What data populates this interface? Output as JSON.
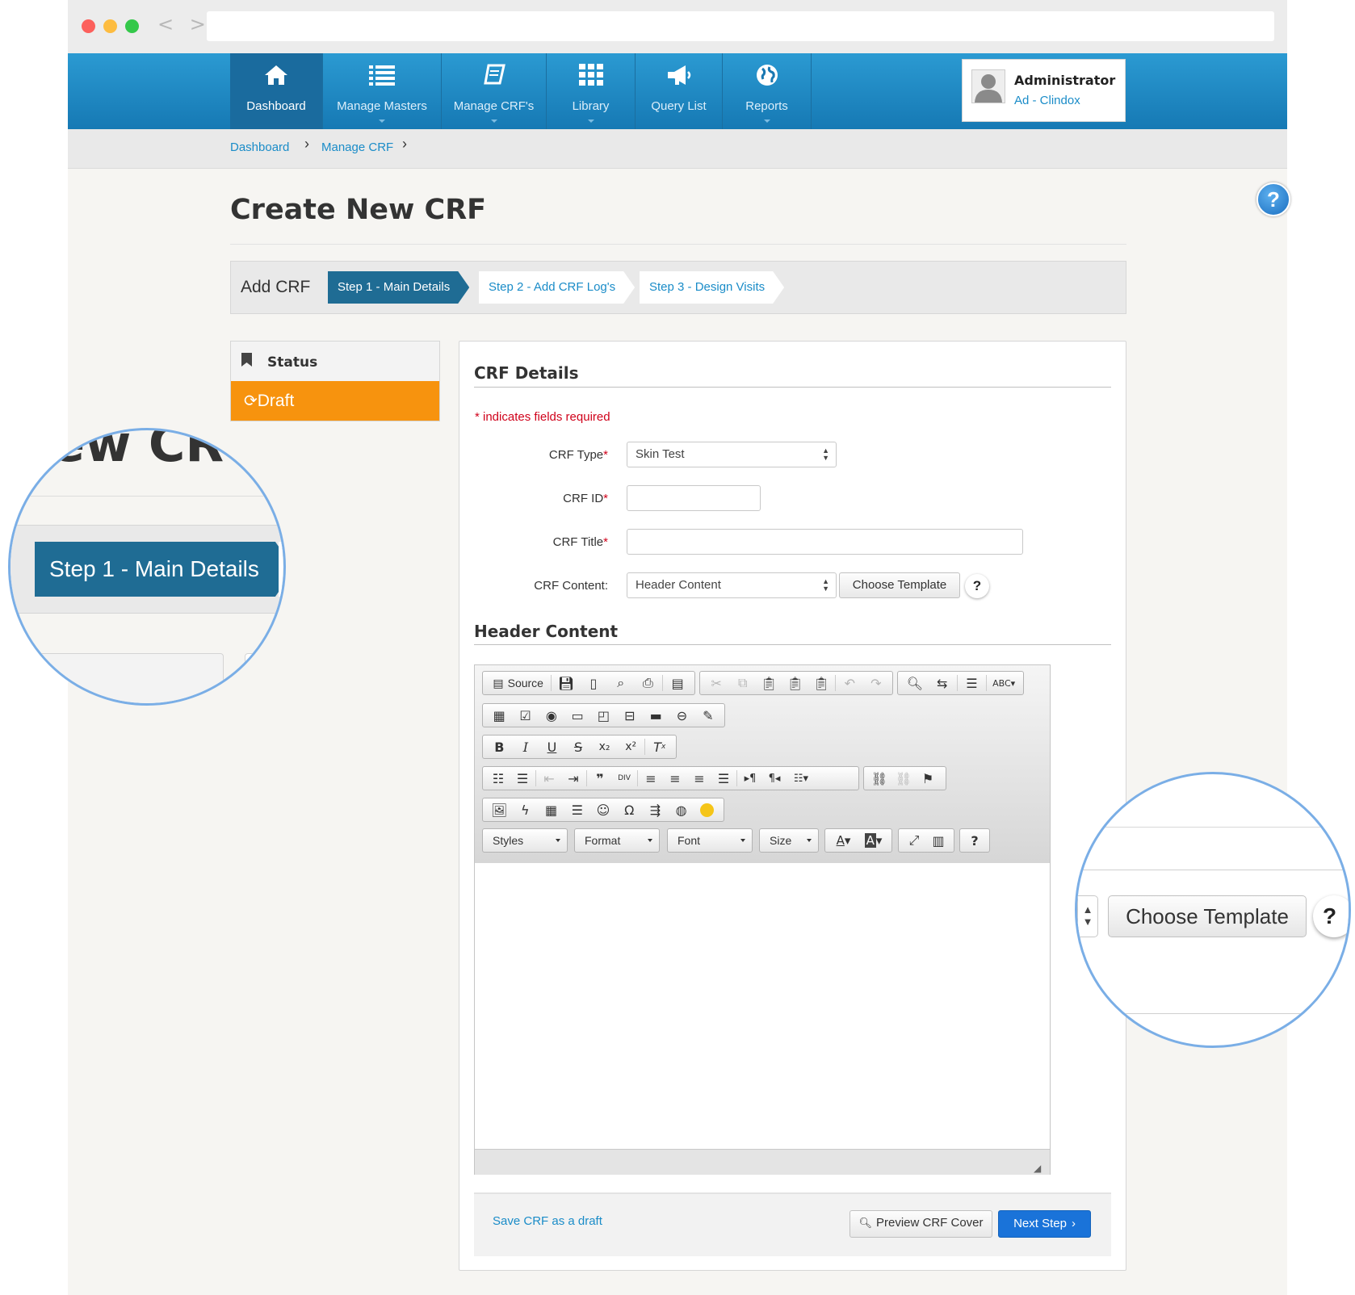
{
  "browser": {
    "nav_arrows": "< >"
  },
  "nav": {
    "items": [
      {
        "label": "Dashboard",
        "icon": "home-icon"
      },
      {
        "label": "Manage Masters",
        "icon": "list-icon"
      },
      {
        "label": "Manage CRF's",
        "icon": "book-icon"
      },
      {
        "label": "Library",
        "icon": "grid-icon"
      },
      {
        "label": "Query List",
        "icon": "megaphone-icon"
      },
      {
        "label": "Reports",
        "icon": "globe-icon"
      }
    ],
    "accent": "#1a8cc8"
  },
  "user": {
    "name": "Administrator",
    "org": "Ad - Clindox"
  },
  "breadcrumb": {
    "items": [
      "Dashboard",
      "Manage CRF"
    ]
  },
  "page": {
    "title": "Create New CRF",
    "help": "?"
  },
  "steps": {
    "label": "Add CRF",
    "items": [
      "Step 1 - Main Details",
      "Step 2 - Add CRF Log's",
      "Step 3 - Design Visits"
    ]
  },
  "status": {
    "heading": "Status",
    "value": "Draft",
    "color": "#f7930e"
  },
  "form": {
    "section_title": "CRF Details",
    "required_note": "* indicates fields required",
    "crf_type_label": "CRF Type",
    "crf_type_value": "Skin Test",
    "crf_id_label": "CRF ID",
    "crf_id_value": "",
    "crf_title_label": "CRF Title",
    "crf_title_value": "",
    "crf_content_label": "CRF Content:",
    "crf_content_value": "Header Content",
    "choose_template": "Choose Template",
    "help": "?",
    "required_star": "*"
  },
  "editor": {
    "section_title": "Header Content",
    "source_label": "Source",
    "styles": "Styles",
    "format": "Format",
    "font": "Font",
    "size": "Size",
    "help": "?"
  },
  "footer": {
    "save_draft": "Save CRF as a draft",
    "preview": "Preview CRF Cover",
    "next": "Next Step"
  },
  "zoom": {
    "title_fragment": "ew CR",
    "step": "Step 1 - Main Details",
    "choose_template": "Choose Template",
    "help": "?"
  }
}
